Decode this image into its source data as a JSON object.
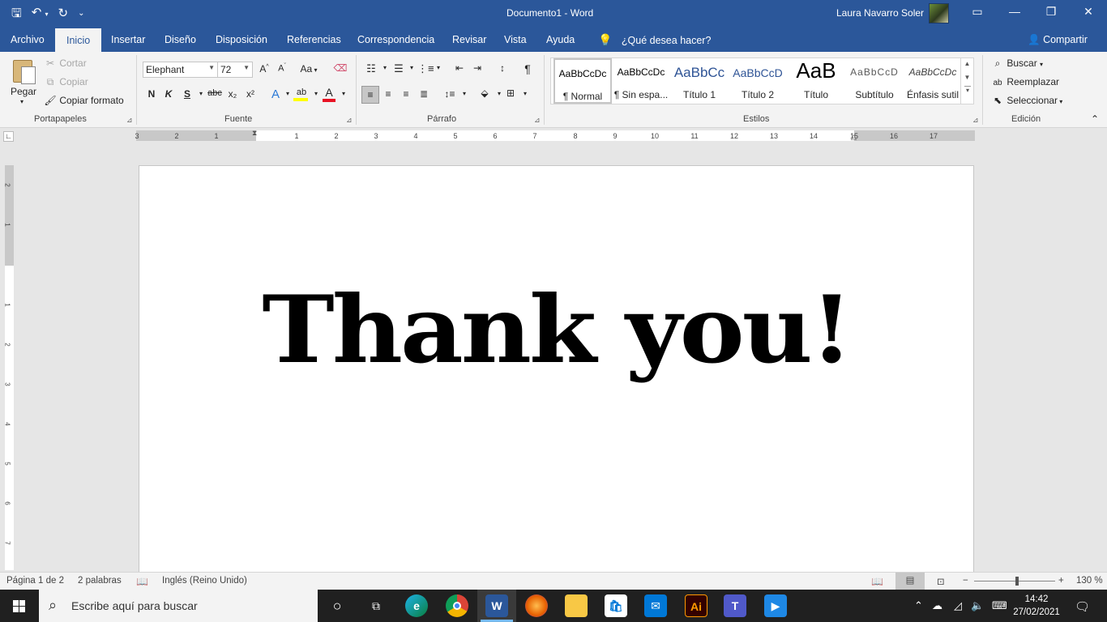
{
  "titlebar": {
    "doc_title": "Documento1  -  Word",
    "user": "Laura Navarro Soler"
  },
  "tabs": [
    "Archivo",
    "Inicio",
    "Insertar",
    "Diseño",
    "Disposición",
    "Referencias",
    "Correspondencia",
    "Revisar",
    "Vista",
    "Ayuda"
  ],
  "tell_me": "¿Qué desea hacer?",
  "share": "Compartir",
  "clipboard": {
    "paste": "Pegar",
    "cut": "Cortar",
    "copy": "Copiar",
    "format_painter": "Copiar formato",
    "label": "Portapapeles"
  },
  "font": {
    "name": "Elephant",
    "size": "72",
    "label": "Fuente",
    "change_case": "Aa",
    "bold": "N",
    "italic": "K",
    "underline": "S",
    "strikethrough": "abc",
    "subscript": "x₂",
    "superscript": "x²"
  },
  "paragraph": {
    "label": "Párrafo"
  },
  "styles": {
    "label": "Estilos",
    "items": [
      {
        "sample": "AaBbCcDc",
        "name": "¶ Normal"
      },
      {
        "sample": "AaBbCcDc",
        "name": "¶ Sin espa..."
      },
      {
        "sample": "AaBbCc",
        "name": "Título 1"
      },
      {
        "sample": "AaBbCcD",
        "name": "Título 2"
      },
      {
        "sample": "AaB",
        "name": "Título"
      },
      {
        "sample": "AaBbCcD",
        "name": "Subtítulo"
      },
      {
        "sample": "AaBbCcDc",
        "name": "Énfasis sutil"
      }
    ]
  },
  "editing": {
    "find": "Buscar",
    "replace": "Reemplazar",
    "select": "Seleccionar",
    "label": "Edición"
  },
  "ruler_ticks": [
    "3",
    "2",
    "1",
    "1",
    "2",
    "3",
    "4",
    "5",
    "6",
    "7",
    "8",
    "9",
    "10",
    "11",
    "12",
    "13",
    "14",
    "15",
    "16",
    "17"
  ],
  "vruler_ticks": [
    "2",
    "1",
    "1",
    "2",
    "3",
    "4",
    "5",
    "6",
    "7"
  ],
  "document": {
    "text": "Thank you!"
  },
  "status": {
    "page": "Página 1 de 2",
    "words": "2 palabras",
    "language": "Inglés (Reino Unido)",
    "zoom": "130 %"
  },
  "taskbar": {
    "search_placeholder": "Escribe aquí para buscar",
    "time": "14:42",
    "date": "27/02/2021"
  },
  "colors": {
    "word_blue": "#2b579a",
    "ribbon_bg": "#f3f3f3",
    "taskbar_bg": "#202020",
    "highlight_yellow": "#ffff00",
    "font_color_red": "#e81123"
  }
}
